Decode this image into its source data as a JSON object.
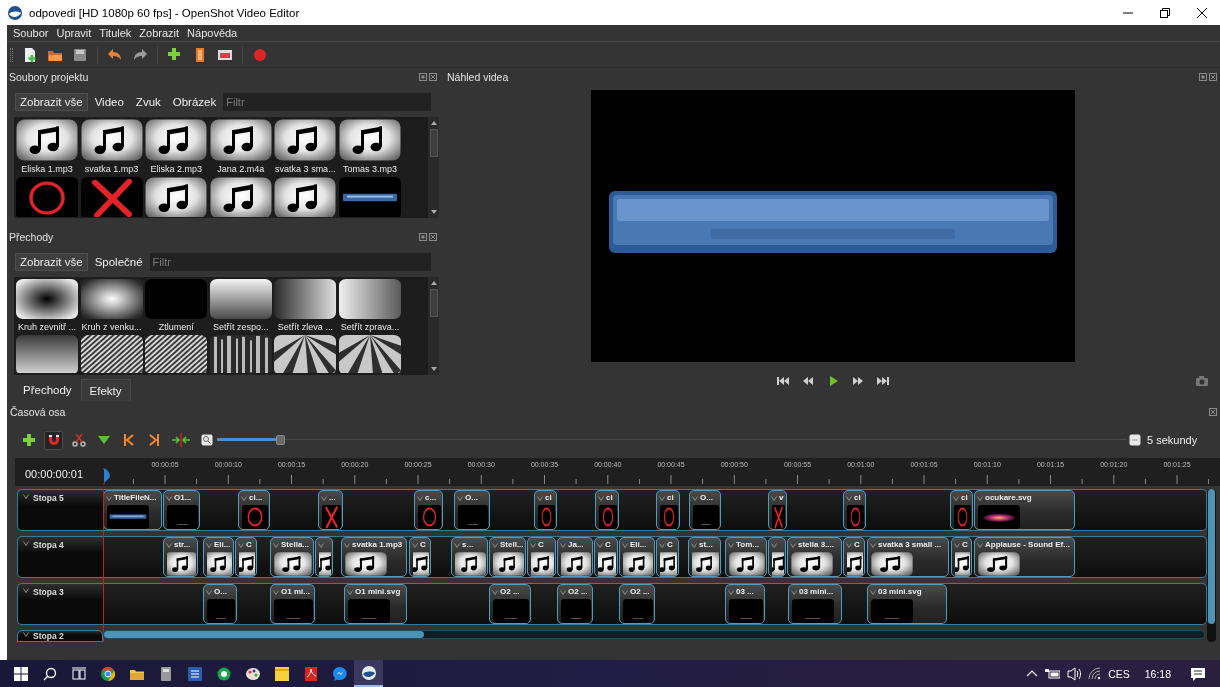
{
  "window": {
    "title": "odpovedi [HD 1080p 60 fps] - OpenShot Video Editor"
  },
  "menu": [
    "Soubor",
    "Upravit",
    "Titulek",
    "Zobrazit",
    "Nápověda"
  ],
  "project_files": {
    "title": "Soubory projektu",
    "filters": [
      {
        "label": "Zobrazit vše",
        "selected": true
      },
      {
        "label": "Video",
        "selected": false
      },
      {
        "label": "Zvuk",
        "selected": false
      },
      {
        "label": "Obrázek",
        "selected": false
      }
    ],
    "search": {
      "placeholder": "Filtr"
    },
    "items": [
      {
        "label": "Eliska 1.mp3",
        "kind": "audio"
      },
      {
        "label": "svatka 1.mp3",
        "kind": "audio"
      },
      {
        "label": "Eliska 2.mp3",
        "kind": "audio"
      },
      {
        "label": "Jana 2.m4a",
        "kind": "audio"
      },
      {
        "label": "svatka 3 sma...",
        "kind": "audio"
      },
      {
        "label": "Tomas 3.mp3",
        "kind": "audio"
      },
      {
        "kind": "circle"
      },
      {
        "kind": "cross"
      },
      {
        "kind": "audio"
      },
      {
        "kind": "audio"
      },
      {
        "kind": "audio"
      },
      {
        "kind": "title"
      }
    ]
  },
  "transitions": {
    "title": "Přechody",
    "filters": [
      {
        "label": "Zobrazit vše",
        "selected": true
      },
      {
        "label": "Společné",
        "selected": false
      }
    ],
    "search": {
      "placeholder": "Filtr"
    },
    "items": [
      {
        "label": "Kruh zevnitř ...",
        "kind": "radial-dark"
      },
      {
        "label": "Kruh z venku...",
        "kind": "radial-light"
      },
      {
        "label": "Ztlumení",
        "kind": "black"
      },
      {
        "label": "Setřít zespo...",
        "kind": "fade-down"
      },
      {
        "label": "Setřít zleva ...",
        "kind": "fade-right"
      },
      {
        "label": "Setřít zprava...",
        "kind": "fade-left"
      },
      {
        "kind": "fade-up"
      },
      {
        "kind": "stripes"
      },
      {
        "kind": "stripes"
      },
      {
        "kind": "noise"
      },
      {
        "kind": "rays"
      },
      {
        "kind": "rays"
      }
    ]
  },
  "panel_tabs": [
    {
      "label": "Přechody",
      "selected": true
    },
    {
      "label": "Efekty",
      "selected": false
    }
  ],
  "preview": {
    "title": "Náhled videa"
  },
  "timeline": {
    "title": "Časová osa",
    "snapping": true,
    "zoom": {
      "level": 0.07,
      "label": "5 sekundy"
    },
    "timecode": "00:00:00:01",
    "ruler": [
      "00:00:05",
      "00:00:10",
      "00:00:15",
      "00:00:20",
      "00:00:25",
      "00:00:30",
      "00:00:35",
      "00:00:40",
      "00:00:45",
      "00:00:50",
      "00:00:55",
      "00:01:00",
      "00:01:05",
      "00:01:10",
      "00:01:15",
      "00:01:20",
      "00:01:25"
    ],
    "tracks": [
      {
        "name": "Stopa 5",
        "clips": [
          {
            "label": "TitleFileN...",
            "kind": "title"
          },
          {
            "label": "O1...",
            "kind": "dark"
          },
          {
            "label": "ci...",
            "kind": "circle"
          },
          {
            "label": "...",
            "kind": "cross"
          },
          {
            "label": "c...",
            "kind": "circle"
          },
          {
            "label": "O...",
            "kind": "dark"
          },
          {
            "label": "ci",
            "kind": "circle"
          },
          {
            "label": "ci",
            "kind": "circle"
          },
          {
            "label": "ci",
            "kind": "circle"
          },
          {
            "label": "O...",
            "kind": "dark"
          },
          {
            "label": "v",
            "kind": "cross"
          },
          {
            "label": "ci",
            "kind": "circle"
          },
          {
            "label": "ci",
            "kind": "circle"
          },
          {
            "label": "ocukare.svg",
            "kind": "sparkle"
          }
        ]
      },
      {
        "name": "Stopa 4",
        "clips": [
          {
            "label": "str...",
            "kind": "audio"
          },
          {
            "label": "Eli...",
            "kind": "audio"
          },
          {
            "label": "C",
            "kind": "audio"
          },
          {
            "label": "Stella...",
            "kind": "audio"
          },
          {
            "kind": "audio"
          },
          {
            "label": "svatka 1.mp3",
            "kind": "audio"
          },
          {
            "label": "C",
            "kind": "audio"
          },
          {
            "label": "s...",
            "kind": "audio"
          },
          {
            "label": "Stell...",
            "kind": "audio"
          },
          {
            "label": "C",
            "kind": "audio"
          },
          {
            "label": "Ja...",
            "kind": "audio"
          },
          {
            "label": "C",
            "kind": "audio"
          },
          {
            "label": "Eli...",
            "kind": "audio"
          },
          {
            "label": "C",
            "kind": "audio"
          },
          {
            "label": "st...",
            "kind": "audio"
          },
          {
            "label": "Tom...",
            "kind": "audio"
          },
          {
            "kind": "audio"
          },
          {
            "label": "stella 3....",
            "kind": "audio"
          },
          {
            "label": "C",
            "kind": "audio"
          },
          {
            "label": "svatka 3 small ...",
            "kind": "audio"
          },
          {
            "label": "C",
            "kind": "audio"
          },
          {
            "label": "Applause - Sound Ef...",
            "kind": "audio"
          }
        ]
      },
      {
        "name": "Stopa 3",
        "clips": [
          {
            "label": "O...",
            "kind": "dark"
          },
          {
            "label": "O1 mi...",
            "kind": "dark"
          },
          {
            "label": "O1 mini.svg",
            "kind": "dark"
          },
          {
            "label": "O2 ...",
            "kind": "dark"
          },
          {
            "label": "O2 ...",
            "kind": "dark"
          },
          {
            "label": "O2 ...",
            "kind": "dark"
          },
          {
            "label": "03 ...",
            "kind": "dark"
          },
          {
            "label": "03 mini...",
            "kind": "dark"
          },
          {
            "label": "03 mini.svg",
            "kind": "dark"
          }
        ]
      },
      {
        "name": "Stopa 2"
      }
    ]
  },
  "taskbar": {
    "language": "CES",
    "clock": "16:18"
  }
}
